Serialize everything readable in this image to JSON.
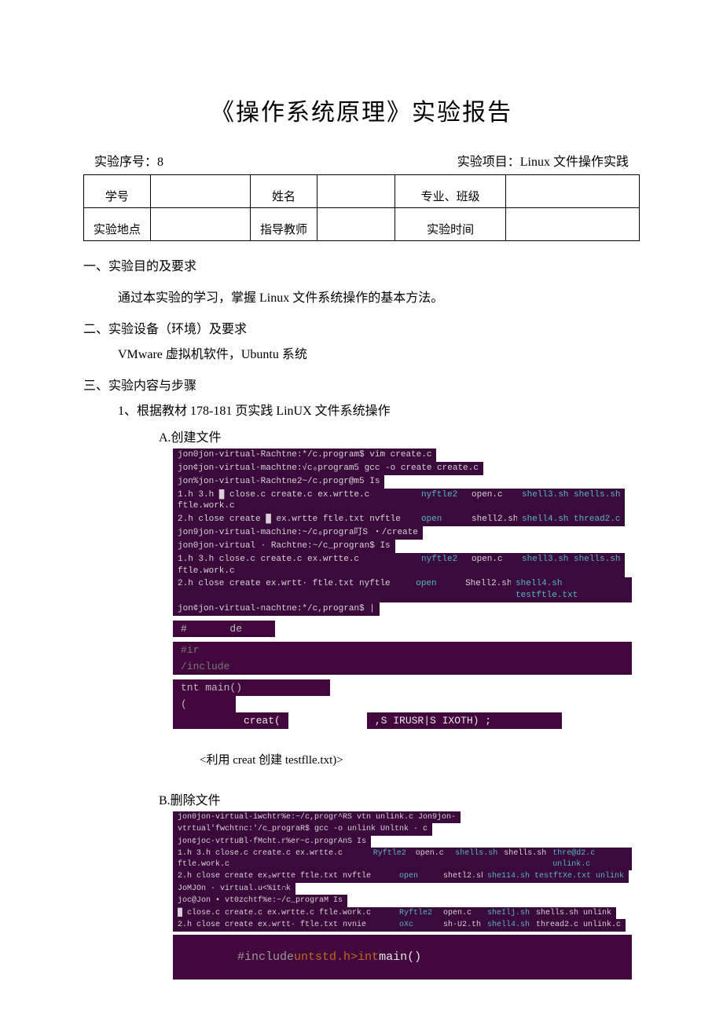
{
  "title": "《操作系统原理》实验报告",
  "meta": {
    "seq_label": "实验序号：8",
    "proj_label": "实验项目：Linux 文件操作实践"
  },
  "table": {
    "r1c1": "学号",
    "r1c3": "姓名",
    "r1c5": "专业、班级",
    "r2c1": "实验地点",
    "r2c3": "指导教师",
    "r2c5": "实验时间"
  },
  "sect1_title": "一、实验目的及要求",
  "sect1_body": "通过本实验的学习，掌握 Linux 文件系统操作的基本方法。",
  "sect2_title": "二、实验设备（环境）及要求",
  "sect2_body": "VMware 虚拟机软件，Ubuntu 系统",
  "sect3_title": "三、实验内容与步骤",
  "sect3_step1": "1、根据教材 178-181 页实践 LinUX 文件系统操作",
  "sect3_A": "A.创建文件",
  "termA": {
    "l1": "jon0jon-virtual-Rachtne:*/c.program$ vim create.c",
    "l2": "jon¢jon-virtual·machtne:√c₀program5 gcc -o create create.c",
    "l3": "jon%jon-virtual-Rachtne2~/c.progr@m5 Is",
    "l4a": "1.h 3.h █ close.c create.c ex.wrtte.c ftle.work.c",
    "l4b": "nyftle2",
    "l4c": "open.c",
    "l4d": "shell3.sh  shells.sh",
    "l5a": "2.h close create █ ex.wrtte ftle.txt nvftle",
    "l5b": "open",
    "l5c": "shell2.sh",
    "l5d": "shell4.sh  thread2.c",
    "l6": "jon9jon-virtual-machine:~/c₀progra叮S  ・/create",
    "l7": "jon0jon-virtual · Rachtne:~/c_progran$ Is",
    "l8a": "1.h 3.h close.c create.c ex.wrtte.c ftle.work.c",
    "l8b": "nyftle2",
    "l8c": "open.c",
    "l8d": "shell3.sh  shells.sh",
    "l9a": "2.h close create ex.wrtt· ftle.txt           nyftle",
    "l9b": "open",
    "l9c": "Shell2.sh",
    "l9d": "shell4.sh  testftle.txt",
    "l10": "jon¢jon-virtual-nachtne:*/c,progran$ |"
  },
  "codeA": {
    "c1": "#       de",
    "c2": "#ir",
    "c3": "/include",
    "c4": "tnt main()",
    "c5": "(",
    "c6a": "creat(",
    "c6b": ",S IRUSR|S IXOTH) ;"
  },
  "captionA": "<利用 creat 创建 testflle.txt)>",
  "sect3_B": "B.删除文件",
  "termB": {
    "l1": "jon0jon-virtual·iwchtr%e:~/c,progr^RS vtn unlink.c Jon9jon-",
    "l1b": "vtrtual'fwchtnc:'/c_prograR$ gcc -o unlink Unltnk · c",
    "l2": "jon¢joc·vtrtuВl·fMcht.r%er~c.progrAnS Is",
    "l3a": "1.h  3.h  close.c  create.c  ex.wrtte.c    ftle.work.c",
    "l3b": "Ryftle2",
    "l3c": "open.c",
    "l3d": "shells.sh",
    "l3e": "shells.sh",
    "l3f": "thre@d2.c unlink.c",
    "l4a": "2.h  close create  ex₀wrtte   ftle.txt      nvftle",
    "l4b": "open",
    "l4c": "shetl2.sh",
    "l4d": "she114.sh  testftXe.txt unlink",
    "l5": "JoMJOn · virtual.u<%it∩k",
    "l6": "joc@Jon • vt0zchtf%e:~/c_prograM Is",
    "l7a": "    █ close.c create.c ex.wrtte.c ftle.work.c",
    "l7b": "Ryftle2",
    "l7c": "open.c",
    "l7d": "sheIlj.sh",
    "l7e": "shells.sh unlink",
    "l8a": "2.h close create ex.wrtt· ftle.txt          nvnie",
    "l8b": "oXc",
    "l8c": "sh·U2.th",
    "l8d": "shell4.sh",
    "l8e": "thread2.c unlink.c"
  },
  "codeB": {
    "c1a": "#include",
    "c1b": "untstd.h>",
    "c1c": "int",
    "c1d": "main()"
  }
}
